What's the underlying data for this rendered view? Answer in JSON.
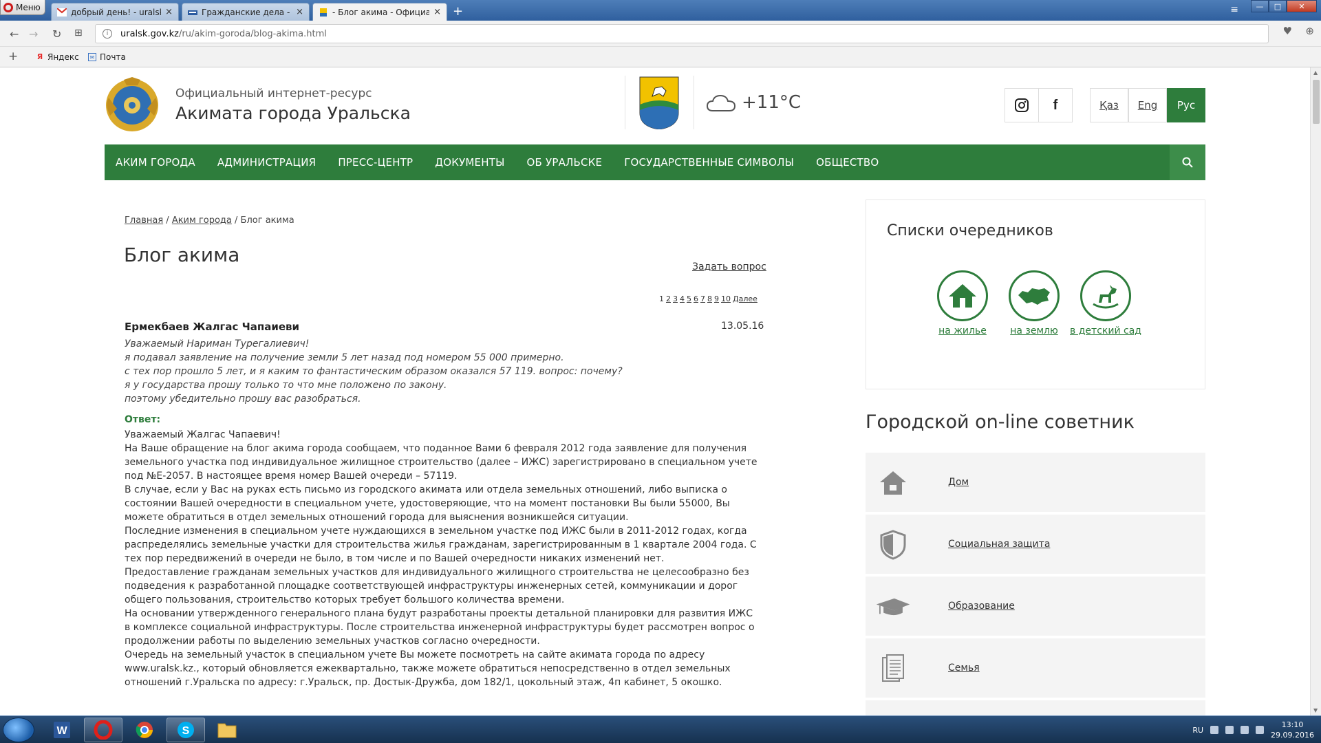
{
  "browser": {
    "menu_label": "Меню",
    "tabs": [
      {
        "title": "добрый день! - uralskwe",
        "close": "×"
      },
      {
        "title": "Гражданские дела - сен ",
        "close": "×"
      },
      {
        "title": "- Блог акима - Официаль",
        "close": "×"
      }
    ],
    "new_tab": "+",
    "url_host": "uralsk.gov.kz",
    "url_path": "/ru/akim-goroda/blog-akima.html",
    "bookmarks": [
      {
        "label": "Яндекс",
        "icon": "yandex-icon"
      },
      {
        "label": "Почта",
        "icon": "mail-icon"
      }
    ]
  },
  "site": {
    "subtitle": "Официальный интернет-ресурс",
    "title": "Акимата города Уральска",
    "weather": "+11°C",
    "languages": [
      {
        "label": "Қаз",
        "active": false
      },
      {
        "label": "Eng",
        "active": false
      },
      {
        "label": "Рус",
        "active": true
      }
    ],
    "menu": [
      "АКИМ ГОРОДА",
      "АДМИНИСТРАЦИЯ",
      "ПРЕСС-ЦЕНТР",
      "ДОКУМЕНТЫ",
      "ОБ УРАЛЬСКЕ",
      "ГОСУДАРСТВЕННЫЕ СИМВОЛЫ",
      "ОБЩЕСТВО"
    ]
  },
  "content": {
    "breadcrumbs": {
      "home": "Главная",
      "sep1": " / ",
      "akim": "Аким города",
      "sep2": " / ",
      "current": "Блог акима"
    },
    "title": "Блог акима",
    "ask_link": "Задать вопрос",
    "pager": [
      "1",
      "2",
      "3",
      "4",
      "5",
      "6",
      "7",
      "8",
      "9",
      "10",
      "Далее"
    ],
    "post": {
      "author": "Ермекбаев Жалгас Чапаиеви",
      "date": "13.05.16",
      "question": [
        "Уважаемый Нариман Турегалиевич!",
        "я подавал заявление на получение земли 5 лет назад под номером 55 000 примерно.",
        "с тех пор прошло 5 лет, и я каким то фантастическим образом оказался 57 119. вопрос: почему?",
        "я у государства прошу только то что мне положено по закону.",
        "поэтому убедительно прошу вас разобраться."
      ],
      "answer_label": "Ответ:",
      "answer": [
        "Уважаемый Жалгас Чапаевич!",
        "На Ваше обращение на блог акима города сообщаем, что поданное Вами 6 февраля 2012 года заявление для получения земельного участка под индивидуальное жилищное строительство (далее – ИЖС) зарегистрировано в специальном учете под №Е-2057. В настоящее время номер Вашей очереди – 57119.",
        "В случае, если у Вас на руках есть письмо из городского акимата или отдела земельных отношений, либо выписка о состоянии Вашей очередности в специальном учете, удостоверяющие, что на момент постановки Вы были 55000, Вы можете обратиться в отдел земельных отношений города для выяснения возникшейся ситуации.",
        "Последние изменения в специальном учете нуждающихся в земельном участке под ИЖС были в 2011-2012 годах, когда распределялись земельные участки для строительства жилья гражданам, зарегистрированным в 1 квартале 2004 года. С тех пор передвижений в очереди не было, в том числе и по Вашей очередности никаких изменений нет.",
        "Предоставление гражданам земельных участков для индивидуального жилищного строительства не целесообразно без подведения к разработанной площадке соответствующей инфраструктуры инженерных сетей, коммуникации и дорог общего пользования, строительство которых требует большого количества времени.",
        "На основании утвержденного генерального плана будут разработаны проекты детальной планировки для развития ИЖС в комплексе социальной инфраструктуры. После строительства инженерной инфраструктуры будет рассмотрен вопрос о продолжении работы по выделению земельных участков согласно очередности.",
        "Очередь на земельный участок в специальном учете Вы можете посмотреть на сайте акимата города по адресу www.uralsk.kz., который обновляется ежеквартально, также можете обратиться непосредственно в отдел земельных отношений г.Уральска по адресу: г.Уральск, пр. Достык-Дружба, дом 182/1, цокольный этаж, 4п кабинет, 5 окошко."
      ]
    }
  },
  "sidebar": {
    "queues_title": "Списки очередников",
    "queues": [
      {
        "label": "на жилье",
        "icon": "house-icon"
      },
      {
        "label": "на землю",
        "icon": "kazakhstan-map-icon"
      },
      {
        "label": "в детский сад",
        "icon": "rocking-horse-icon"
      }
    ],
    "advisor_title": "Городской on-line советник",
    "advisor": [
      {
        "label": "Дом",
        "icon": "home-icon"
      },
      {
        "label": "Социальная защита",
        "icon": "shield-icon"
      },
      {
        "label": "Образование",
        "icon": "graduation-cap-icon"
      },
      {
        "label": "Семья",
        "icon": "document-icon"
      }
    ]
  },
  "taskbar": {
    "lang": "RU",
    "time": "13:10",
    "date": "29.09.2016"
  },
  "colors": {
    "brand_green": "#2e7d3c"
  }
}
